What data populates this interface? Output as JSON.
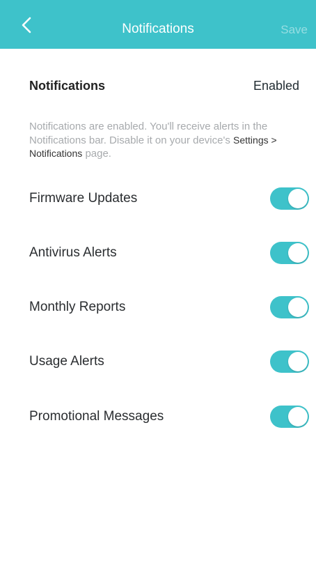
{
  "header": {
    "title": "Notifications",
    "save_label": "Save",
    "back_icon": "chevron-left-icon",
    "background_color": "#3ec2ca"
  },
  "master": {
    "label": "Notifications",
    "status": "Enabled"
  },
  "description": {
    "text_before": "Notifications are enabled. You'll receive alerts in the Notifications bar. Disable it on your device's",
    "emphasis": "Settings > Notifications",
    "text_after": "page."
  },
  "toggles": [
    {
      "label": "Firmware Updates",
      "on": true
    },
    {
      "label": "Antivirus Alerts",
      "on": true
    },
    {
      "label": "Monthly Reports",
      "on": true
    },
    {
      "label": "Usage Alerts",
      "on": true
    },
    {
      "label": "Promotional Messages",
      "on": true
    }
  ],
  "colors": {
    "accent": "#3ec2ca",
    "muted_text": "#a7aaad"
  }
}
